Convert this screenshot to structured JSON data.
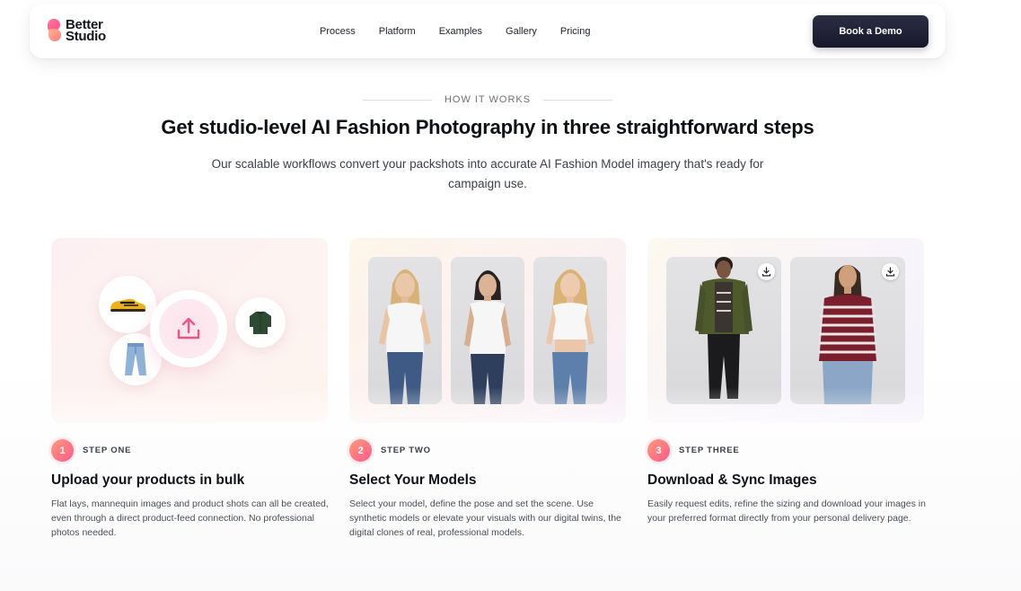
{
  "header": {
    "logo_line1": "Better",
    "logo_line2": "Studio",
    "nav": [
      "Process",
      "Platform",
      "Examples",
      "Gallery",
      "Pricing"
    ],
    "cta": "Book a Demo"
  },
  "section": {
    "eyebrow": "HOW IT WORKS",
    "title": "Get studio-level AI Fashion Photography in three straightforward steps",
    "subtitle": "Our scalable workflows convert your packshots into accurate AI Fashion Model imagery that's ready for campaign use."
  },
  "steps": [
    {
      "number": "1",
      "label": "STEP ONE",
      "title": "Upload your products in bulk",
      "description": "Flat lays, mannequin images and product shots can all be created, even through a direct product-feed connection. No professional photos needed."
    },
    {
      "number": "2",
      "label": "STEP TWO",
      "title": "Select Your Models",
      "description": "Select your model, define the pose and set the scene. Use synthetic models or elevate your visuals with our digital twins, the digital clones of real, professional models."
    },
    {
      "number": "3",
      "label": "STEP THREE",
      "title": "Download & Sync Images",
      "description": "Easily request edits, refine the sizing and download your images in your preferred format directly from your personal delivery page."
    }
  ],
  "colors": {
    "accent_gradient_start": "#ff9a7a",
    "accent_gradient_end": "#ff5a8a",
    "cta_bg": "#1e2036",
    "upload_icon": "#e8558a"
  },
  "icons": [
    "upload-icon",
    "download-icon",
    "shoe-icon",
    "jeans-icon",
    "sweater-icon"
  ]
}
